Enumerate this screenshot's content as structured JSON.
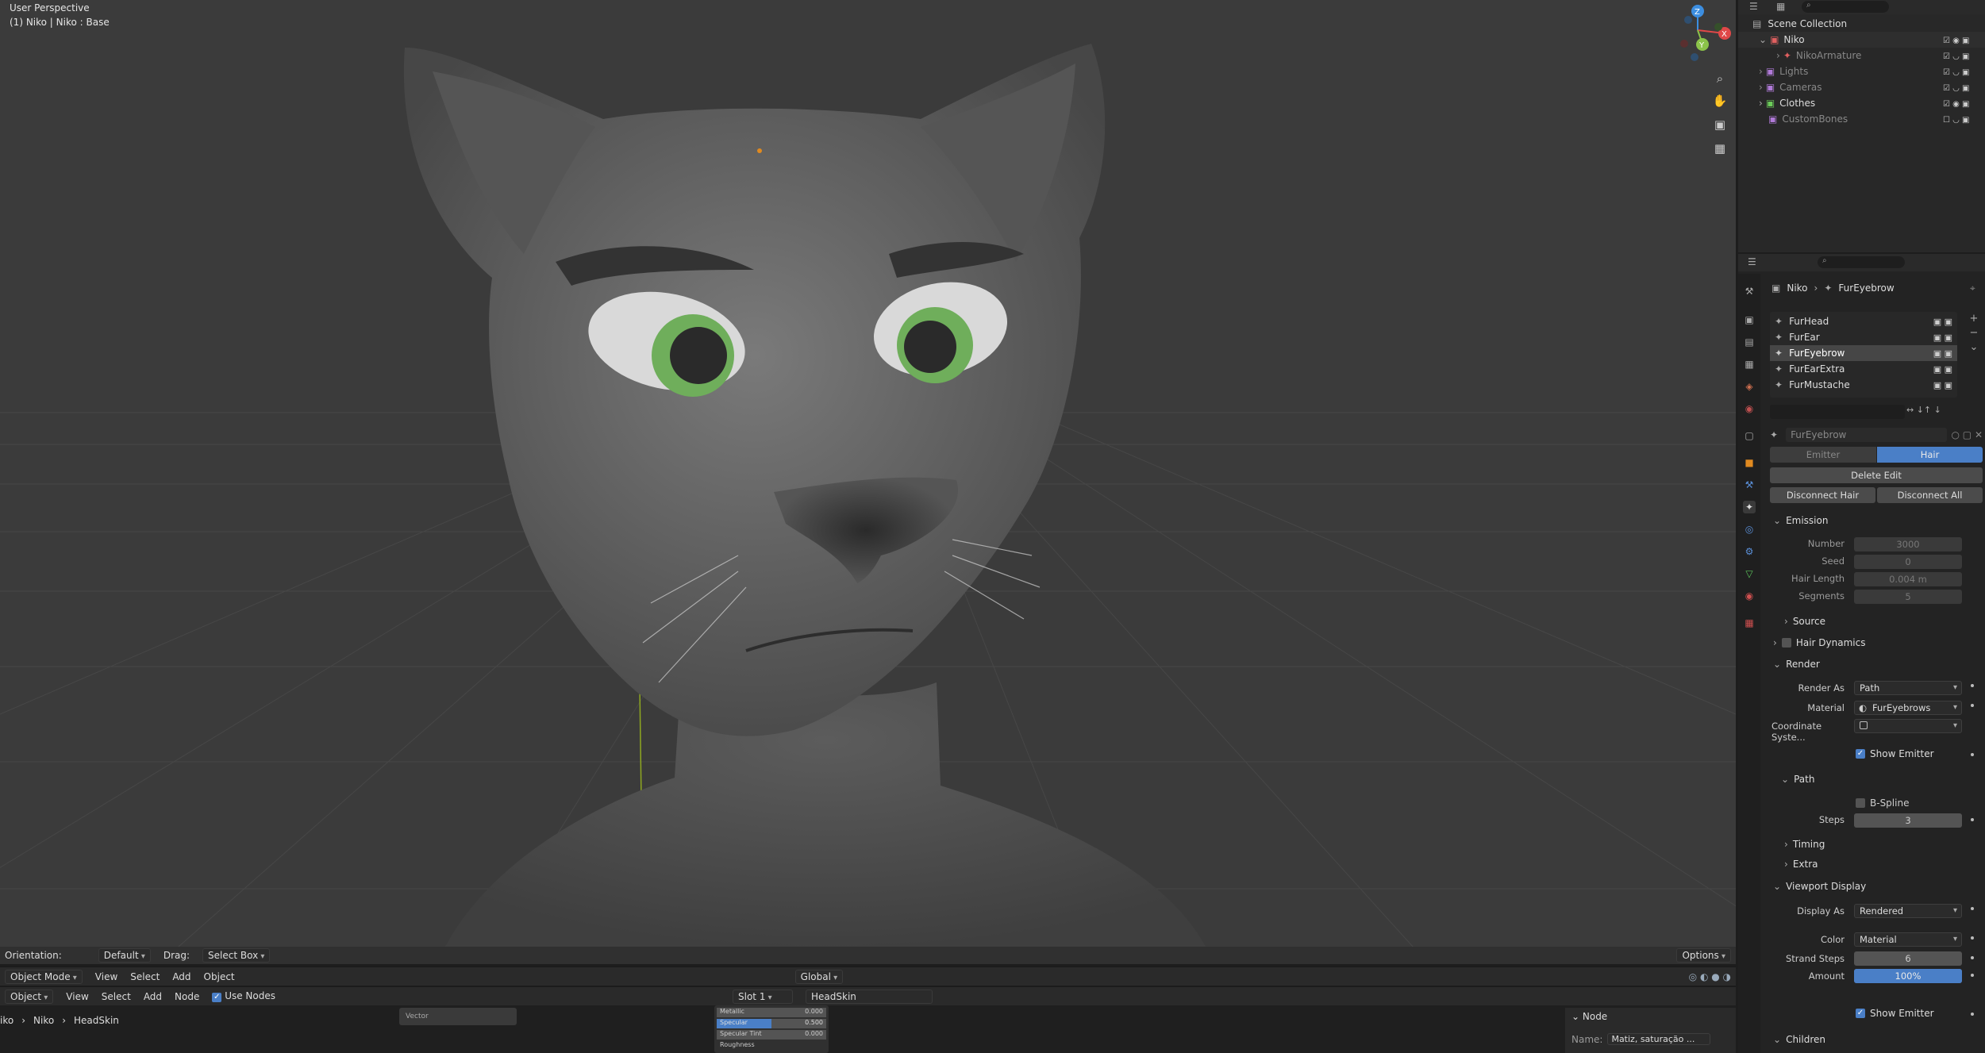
{
  "viewport": {
    "perspective": "User Perspective",
    "object_info": "(1) Niko | Niko : Base",
    "bottom_bar": {
      "orientation_label": "Orientation:",
      "orientation_value": "Default",
      "drag_label": "Drag:",
      "drag_value": "Select Box",
      "options": "Options"
    },
    "header": {
      "mode": "Object Mode",
      "menus": [
        "View",
        "Select",
        "Add",
        "Object"
      ],
      "transform": "Global"
    }
  },
  "node_editor": {
    "type": "Object",
    "menus": [
      "View",
      "Select",
      "Add",
      "Node"
    ],
    "use_nodes": "Use Nodes",
    "slot": "Slot 1",
    "material": "HeadSkin",
    "breadcrumb": [
      "iko",
      "Niko",
      "HeadSkin"
    ],
    "node_vector": "Vector",
    "node_rows": [
      {
        "label": "Metallic",
        "value": "0.000"
      },
      {
        "label": "Specular",
        "value": "0.500"
      },
      {
        "label": "Specular Tint",
        "value": "0.000"
      },
      {
        "label": "Roughness",
        "value": ""
      }
    ],
    "side_panel": {
      "section": "Node",
      "name_label": "Name:",
      "name_value": "Matiz, saturação ..."
    }
  },
  "outliner": {
    "scene_collection": "Scene Collection",
    "items": [
      {
        "label": "Niko",
        "color": "#e06060"
      },
      {
        "label": "NikoArmature",
        "color": "#e06060"
      },
      {
        "label": "Lights",
        "color": "#b07ad8"
      },
      {
        "label": "Cameras",
        "color": "#b07ad8"
      },
      {
        "label": "Clothes",
        "color": "#6ccc5a"
      },
      {
        "label": "CustomBones",
        "color": "#b07ad8"
      }
    ]
  },
  "properties": {
    "breadcrumb": [
      "Niko",
      "FurEyebrow"
    ],
    "particle_systems": [
      "FurHead",
      "FurEar",
      "FurEyebrow",
      "FurEarExtra",
      "FurMustache"
    ],
    "active_system": "FurEyebrow",
    "settings_name": "FurEyebrow",
    "type_tabs": [
      "Emitter",
      "Hair"
    ],
    "buttons": {
      "delete_edit": "Delete Edit",
      "disconnect_hair": "Disconnect Hair",
      "disconnect_all": "Disconnect All"
    },
    "emission": {
      "title": "Emission",
      "fields": [
        {
          "label": "Number",
          "value": "3000"
        },
        {
          "label": "Seed",
          "value": "0"
        },
        {
          "label": "Hair Length",
          "value": "0.004 m"
        },
        {
          "label": "Segments",
          "value": "5"
        }
      ]
    },
    "source": "Source",
    "hair_dynamics": "Hair Dynamics",
    "render": {
      "title": "Render",
      "render_as_label": "Render As",
      "render_as": "Path",
      "material_label": "Material",
      "material": "FurEyebrows",
      "coordinate_label": "Coordinate Syste...",
      "show_emitter": "Show Emitter",
      "path_title": "Path",
      "bspline": "B-Spline",
      "steps_label": "Steps",
      "steps": "3",
      "timing": "Timing",
      "extra": "Extra"
    },
    "viewport_display": {
      "title": "Viewport Display",
      "display_as_label": "Display As",
      "display_as": "Rendered",
      "color_label": "Color",
      "color": "Material",
      "strand_steps_label": "Strand Steps",
      "strand_steps": "6",
      "amount_label": "Amount",
      "amount": "100%",
      "amount_fraction": 1.0,
      "show_emitter": "Show Emitter"
    },
    "children": "Children"
  },
  "colors": {
    "accent": "#4a7fc7",
    "eye_iris": "#6fae5b",
    "axis_x": "#e04848",
    "axis_y": "#8bc34a",
    "axis_z": "#3c8ee0"
  }
}
